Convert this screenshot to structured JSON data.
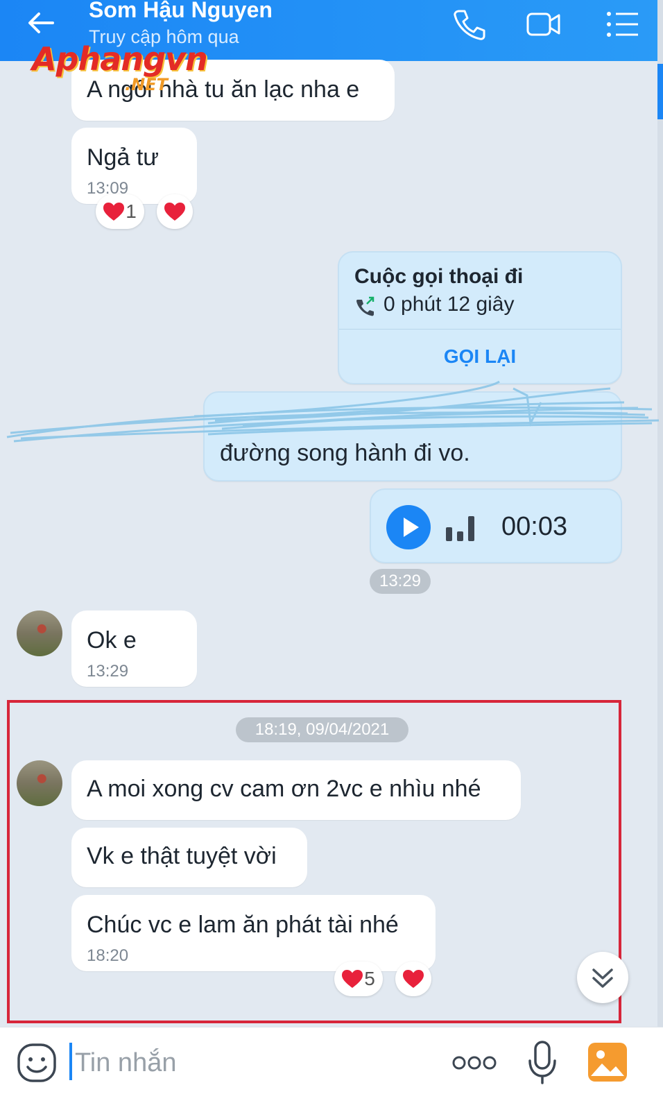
{
  "header": {
    "title": "Som Hậu Nguyen",
    "subtitle": "Truy cập hôm qua"
  },
  "watermark": {
    "logo": "Aphangvn",
    "suffix": ".NET"
  },
  "messages": {
    "m1": {
      "text": "A ngồi nhà tu ăn lạc nha e"
    },
    "m2": {
      "text": "Ngả tư",
      "time": "13:09",
      "reactions": {
        "count": "1"
      }
    },
    "call": {
      "title": "Cuộc gọi thoại đi",
      "duration": "0 phút 12 giây",
      "action": "GỌI LẠI"
    },
    "m3": {
      "text": "đường song hành đi vo."
    },
    "voice": {
      "duration": "00:03",
      "time": "13:29"
    },
    "m4": {
      "text": "Ok e",
      "time": "13:29"
    },
    "separator": "18:19, 09/04/2021",
    "m5": {
      "text": "A moi xong cv cam ơn 2vc e nhìu nhé"
    },
    "m6": {
      "text": "Vk e thật tuyệt vời"
    },
    "m7": {
      "text": "Chúc vc e lam ăn phát tài nhé",
      "time": "18:20",
      "reactions": {
        "count": "5"
      }
    }
  },
  "input": {
    "placeholder": "Tin nhắn"
  },
  "colors": {
    "accent": "#1b86f5",
    "highlight": "#d7263a",
    "heart": "#e8213b"
  }
}
